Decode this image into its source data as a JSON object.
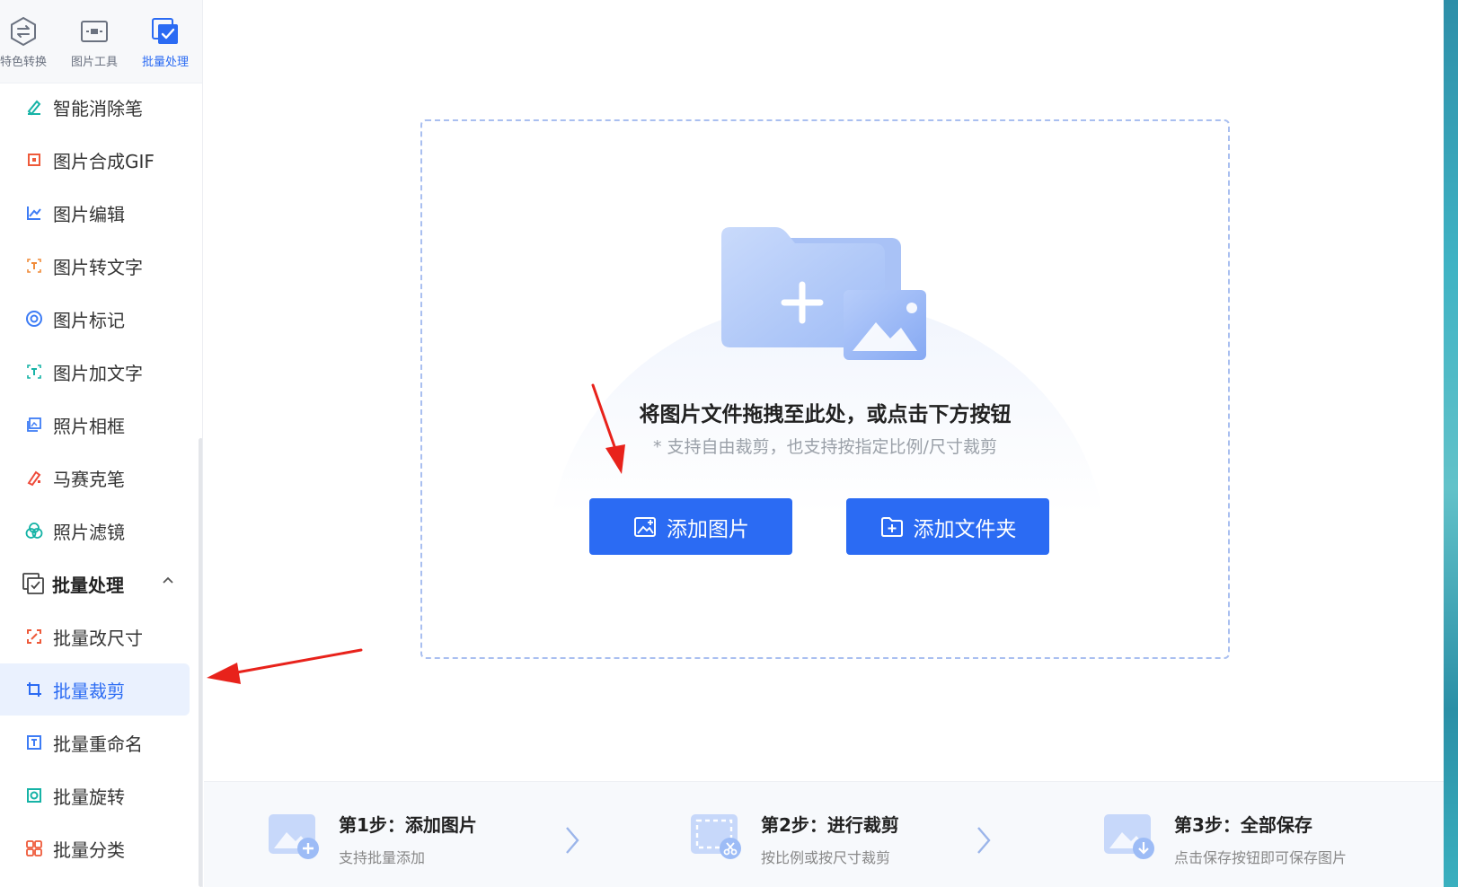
{
  "top_tabs": [
    {
      "label": "特色转换",
      "icon": "convert-icon"
    },
    {
      "label": "图片工具",
      "icon": "image-tool-icon"
    },
    {
      "label": "批量处理",
      "icon": "batch-check-icon",
      "active": true
    }
  ],
  "menu": {
    "items": [
      {
        "label": "智能消除笔",
        "icon": "eraser-pen-icon"
      },
      {
        "label": "图片合成GIF",
        "icon": "gif-icon"
      },
      {
        "label": "图片编辑",
        "icon": "image-edit-icon"
      },
      {
        "label": "图片转文字",
        "icon": "ocr-text-icon"
      },
      {
        "label": "图片标记",
        "icon": "mark-circle-icon"
      },
      {
        "label": "图片加文字",
        "icon": "add-text-icon"
      },
      {
        "label": "照片相框",
        "icon": "photo-frame-icon"
      },
      {
        "label": "马赛克笔",
        "icon": "mosaic-pen-icon"
      },
      {
        "label": "照片滤镜",
        "icon": "filter-icon"
      }
    ],
    "group": {
      "label": "批量处理",
      "icon": "batch-check-icon",
      "expanded": true
    },
    "sub_items": [
      {
        "label": "批量改尺寸",
        "icon": "resize-icon"
      },
      {
        "label": "批量裁剪",
        "icon": "crop-icon",
        "selected": true
      },
      {
        "label": "批量重命名",
        "icon": "rename-icon"
      },
      {
        "label": "批量旋转",
        "icon": "rotate-icon"
      },
      {
        "label": "批量分类",
        "icon": "classify-icon"
      }
    ]
  },
  "dropzone": {
    "title": "将图片文件拖拽至此处，或点击下方按钮",
    "subtitle": "* 支持自由裁剪，也支持按指定比例/尺寸裁剪",
    "add_image_label": "添加图片",
    "add_folder_label": "添加文件夹"
  },
  "steps": [
    {
      "title": "第1步：添加图片",
      "desc": "支持批量添加"
    },
    {
      "title": "第2步：进行裁剪",
      "desc": "按比例或按尺寸裁剪"
    },
    {
      "title": "第3步：全部保存",
      "desc": "点击保存按钮即可保存图片"
    }
  ],
  "colors": {
    "accent": "#2b6bf3",
    "selected_bg": "#eaf1fe",
    "annotation_arrow": "#e8221b"
  }
}
